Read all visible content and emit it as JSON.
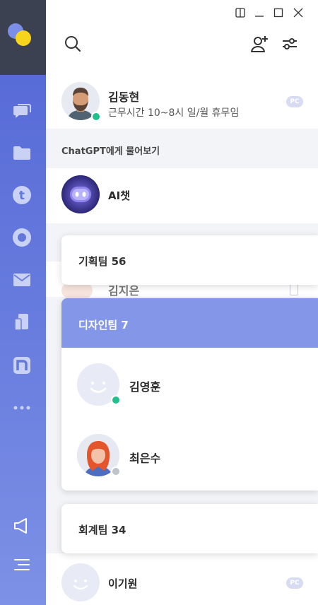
{
  "window": {
    "controls": [
      "sidebar-toggle",
      "minimize",
      "maximize",
      "close"
    ]
  },
  "header": {
    "search_icon": "search-icon",
    "add_friend_icon": "add-user-icon",
    "settings_icon": "sliders-icon"
  },
  "sidebar": {
    "items": [
      "chat-icon",
      "folder-icon",
      "t-icon",
      "record-icon",
      "mail-icon",
      "mobile-icon",
      "n-icon",
      "more-icon"
    ],
    "bottom": [
      "megaphone-icon",
      "menu-icon"
    ]
  },
  "my_profile": {
    "name": "김동현",
    "status_message": "근무시간 10~8시 일/월 휴무임",
    "badge": "PC",
    "status_color": "#1fc08c"
  },
  "chatgpt_section": {
    "label": "ChatGPT에게 물어보기",
    "bot_name": "AI챗"
  },
  "background_rows": {
    "peek_name": "김지은"
  },
  "groups": [
    {
      "title": "기획팀 56"
    },
    {
      "title": "디자인팀 7",
      "members": [
        {
          "name": "김영훈",
          "status_color": "#1fc08c"
        },
        {
          "name": "최은수",
          "status_color": "#bfc3cc"
        }
      ]
    },
    {
      "title": "회계팀 34"
    }
  ],
  "bottom_contact": {
    "name": "이기원",
    "badge": "PC"
  },
  "colors": {
    "accent": "#7b8fe8",
    "sidebar_top": "#3c4151",
    "online": "#1fc08c"
  }
}
